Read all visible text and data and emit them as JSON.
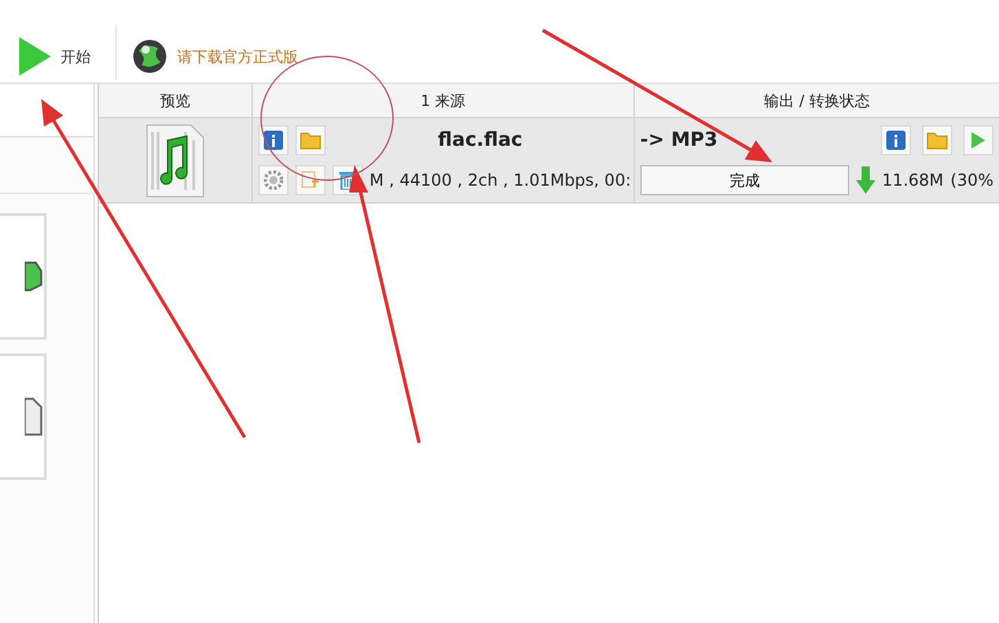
{
  "toolbar": [
    {
      "label": "开始",
      "kind": "start"
    },
    {
      "label": "请下载官方正式版",
      "kind": "download"
    }
  ],
  "table": {
    "columns": [
      "预览",
      "1 来源",
      "输出 / 转换状态"
    ],
    "rows": [
      {
        "source_name": "flac.flac",
        "source_info": "M , 44100 , 2ch , 1.01Mbps, 00:",
        "output_format": "-> MP3",
        "status": "完成",
        "output_size": "11.68M",
        "output_percent": "(30%"
      }
    ]
  }
}
